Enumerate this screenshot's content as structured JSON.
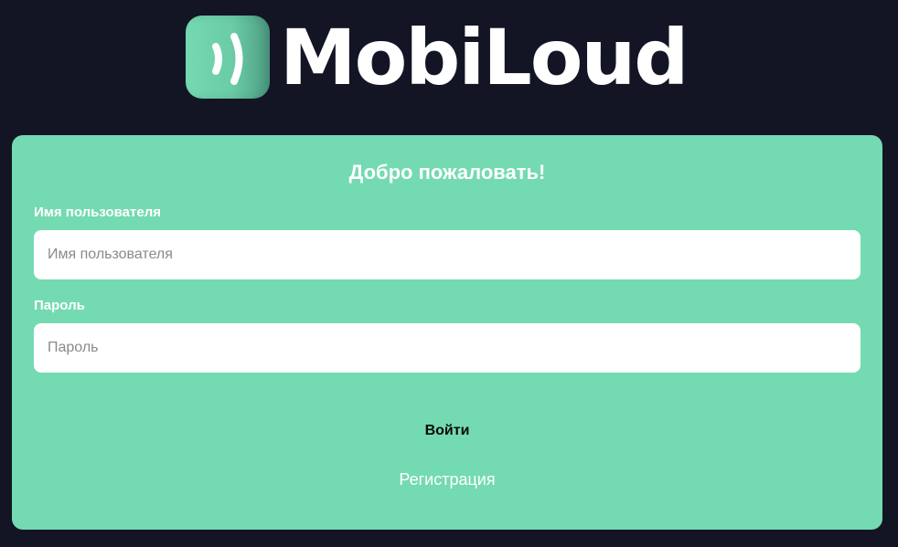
{
  "brand": {
    "name": "MobiLoud",
    "logo_icon": "sound-waves-icon",
    "accent_color": "#74dab2",
    "background_color": "#131525"
  },
  "login_form": {
    "title": "Добро пожаловать!",
    "username": {
      "label": "Имя пользователя",
      "placeholder": "Имя пользователя",
      "value": ""
    },
    "password": {
      "label": "Пароль",
      "placeholder": "Пароль",
      "value": ""
    },
    "submit_label": "Войти",
    "register_label": "Регистрация"
  }
}
